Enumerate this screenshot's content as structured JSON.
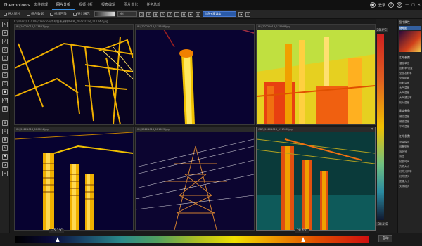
{
  "app": {
    "title": "Thermotools"
  },
  "menu": [
    "文件管理",
    "图片分析",
    "视频分析",
    "报表编辑",
    "图片优化",
    "任务总部"
  ],
  "menu_active": 1,
  "user": {
    "login": "登录",
    "help": "?",
    "settings": "⚙"
  },
  "toolbar": {
    "import": "导入图片",
    "compare": "组合数据",
    "export": "视频回放",
    "report": "导出报告",
    "palette_value": "铁红",
    "scheme_value": "自然+高温度"
  },
  "path": "C:/Users/DT410s/Desktop/冷却管表采样/GBR_20221018_111342.jpg",
  "tiles": [
    {
      "title": "IRI_20221018_113837.jpg"
    },
    {
      "title": "IRI_20221018_115558.jpg"
    },
    {
      "title": "IRI_20221018_115938.jpg"
    },
    {
      "title": "IRI_20221018_120624.jpg"
    },
    {
      "title": "IRI_20221018_121623.jpg"
    },
    {
      "title": "GBR_20221018_111342.jpg"
    }
  ],
  "scale": {
    "max": "28.4°C",
    "min": "-38.1°C"
  },
  "colorbar": {
    "low": "-35.1°C",
    "high": "28.4°C",
    "auto": "自动"
  },
  "right_panel": {
    "header": "图片属性",
    "sub": "缩略图",
    "section1": "红外参数",
    "items1": [
      "温度单位",
      "反射率/设置",
      "全图发射率",
      "全部距离",
      "反射温度",
      "大气温度",
      "大气湿度",
      "大气透过率",
      "相对湿度"
    ],
    "section2": "温度参数",
    "items2": [
      "最高温度",
      "最低温度",
      "平均温度"
    ],
    "section3": "红外参数",
    "items3": [
      "测量模式",
      "设备型号",
      "序列号",
      "测温",
      "拍摄时间",
      "文件大小",
      "红外分辨率",
      "红外镜头",
      "图像大小",
      "文件格式"
    ]
  }
}
